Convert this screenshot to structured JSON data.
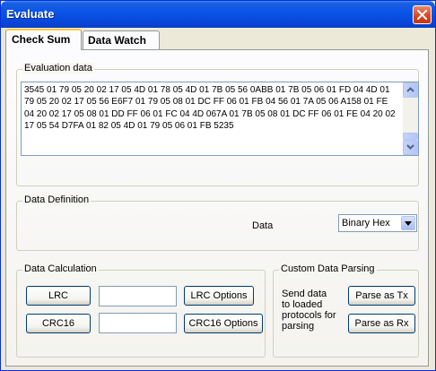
{
  "window": {
    "title": "Evaluate"
  },
  "tabs": [
    {
      "label": "Check Sum"
    },
    {
      "label": "Data Watch"
    }
  ],
  "evaluation": {
    "label": "Evaluation data",
    "text": "3545 01 79 05 20 02 17 05 4D 01 78 05 4D 01 7B 05 56 0ABB 01 7B 05 06 01 FD 04 4D 01 79 05 20 02 17 05 56 E6F7 01 79 05 08 01 DC FF 06 01 FB 04 56 01 7A 05 06 A158 01 FE 04 20 02 17 05 08 01 DD FF 06 01 FC 04 4D 067A 01 7B 05 08 01 DC FF 06 01 FE 04 20 02 17 05 54 D7FA 01 82 05 4D 01 79 05 06 01 FB 5235"
  },
  "definition": {
    "label": "Data Definition",
    "data_label": "Data",
    "selected_format": "Binary Hex"
  },
  "calculation": {
    "label": "Data Calculation",
    "lrc_button": "LRC",
    "lrc_value": "",
    "lrc_options_button": "LRC Options",
    "crc16_button": "CRC16",
    "crc16_value": "",
    "crc16_options_button": "CRC16 Options"
  },
  "parsing": {
    "label": "Custom Data Parsing",
    "description_lines": [
      "Send data",
      "to loaded",
      "protocols for",
      "parsing"
    ],
    "parse_tx_button": "Parse as Tx",
    "parse_rx_button": "Parse as Rx"
  }
}
